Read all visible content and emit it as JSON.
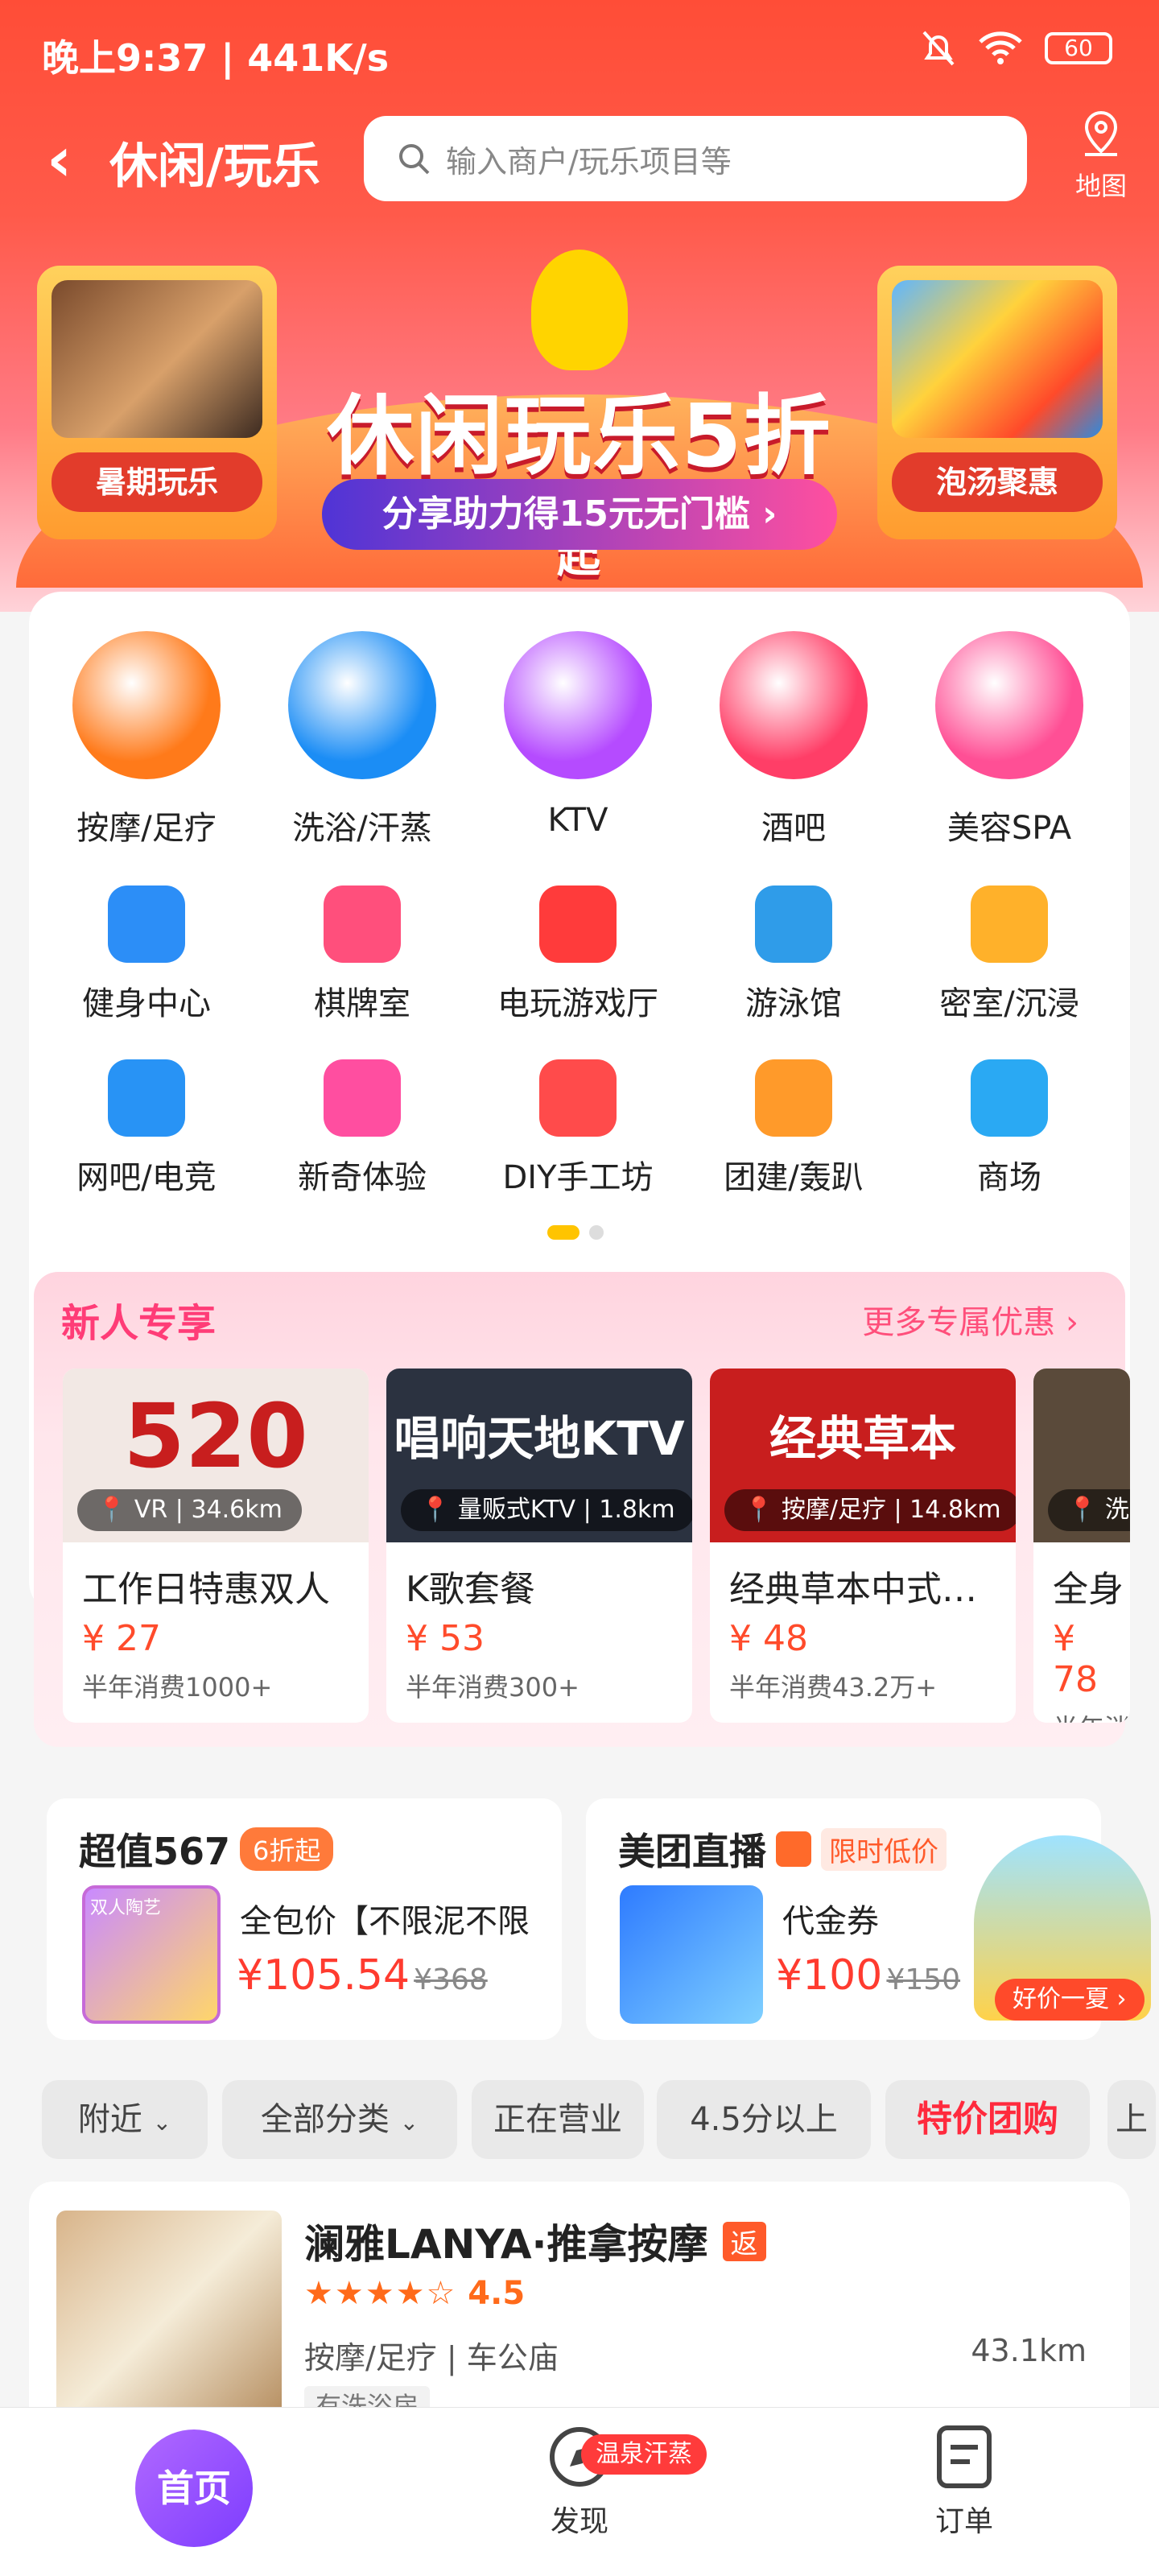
{
  "status": {
    "time": "晚上9:37 | 441K/s",
    "battery": "60"
  },
  "header": {
    "title": "休闲/玩乐",
    "search_placeholder": "输入商户/玩乐项目等",
    "map_label": "地图"
  },
  "banner": {
    "left_tag": "暑期玩乐",
    "right_tag": "泡汤聚惠",
    "main_title": "休闲玩乐5折",
    "main_suffix": "起",
    "subtitle": "分享助力得15元无门槛"
  },
  "categories_big": [
    {
      "label": "按摩/足疗",
      "color": "#ff7a1a",
      "icon": "footprint-icon"
    },
    {
      "label": "洗浴/汗蒸",
      "color": "#1b8df5",
      "icon": "steam-icon"
    },
    {
      "label": "KTV",
      "color": "#b54bff",
      "icon": "microphone-icon"
    },
    {
      "label": "酒吧",
      "color": "#ff3e67",
      "icon": "beer-icon"
    },
    {
      "label": "美容SPA",
      "color": "#ff4f95",
      "icon": "face-mask-icon"
    }
  ],
  "categories_small": [
    {
      "label": "健身中心",
      "color": "#2c8ef7"
    },
    {
      "label": "棋牌室",
      "color": "#ff4f7c"
    },
    {
      "label": "电玩游戏厅",
      "color": "#ff3b3b"
    },
    {
      "label": "游泳馆",
      "color": "#2f9ce9"
    },
    {
      "label": "密室/沉浸",
      "color": "#ffb12a"
    },
    {
      "label": "网吧/电竞",
      "color": "#2893f5"
    },
    {
      "label": "新奇体验",
      "color": "#ff4ea0"
    },
    {
      "label": "DIY手工坊",
      "color": "#ff4b4b"
    },
    {
      "label": "团建/轰趴",
      "color": "#ff9a2a"
    },
    {
      "label": "商场",
      "color": "#2aa9f3"
    }
  ],
  "newuser": {
    "title": "新人专享",
    "more": "更多专属优惠"
  },
  "deals": [
    {
      "loc": "VR | 34.6km",
      "name": "工作日特惠双人",
      "price": "¥ 27",
      "sales": "半年消费1000+",
      "img_color": "#f2e8e4",
      "img_text": "520"
    },
    {
      "loc": "量贩式KTV | 1.8km",
      "name": "K歌套餐",
      "price": "¥ 53",
      "sales": "半年消费300+",
      "img_color": "#2b3240",
      "img_text": "唱响天地KTV"
    },
    {
      "loc": "按摩/足疗 | 14.8km",
      "name": "经典草本中式…",
      "price": "¥ 48",
      "sales": "半年消费43.2万+",
      "img_color": "#c81e1e",
      "img_text": "经典草本"
    },
    {
      "loc": "洗浴",
      "name": "全身",
      "price": "¥ 78",
      "sales": "半年消费",
      "img_color": "#5a4a3a",
      "img_text": ""
    }
  ],
  "promo_left": {
    "title": "超值567",
    "badge": "6折起",
    "item": "全包价【不限泥不限",
    "price": "¥105.54",
    "orig": "¥368",
    "thumb": "双人陶艺"
  },
  "promo_right": {
    "title": "美团直播",
    "badge": "限时低价",
    "item": "代金券",
    "price": "¥100",
    "orig": "¥150",
    "btn": "好价一夏"
  },
  "filters": [
    "附近",
    "全部分类",
    "正在营业",
    "4.5分以上",
    "特价团购",
    "上"
  ],
  "shop": {
    "name": "澜雅LANYA·推拿按摩",
    "tag": "返",
    "rating": "4.5",
    "category": "按摩/足疗",
    "area": "车公庙",
    "distance": "43.1km",
    "extra": "有洗浴房"
  },
  "tabbar": {
    "home": "首页",
    "discover": "发现",
    "discover_badge": "温泉汗蒸",
    "orders": "订单"
  }
}
